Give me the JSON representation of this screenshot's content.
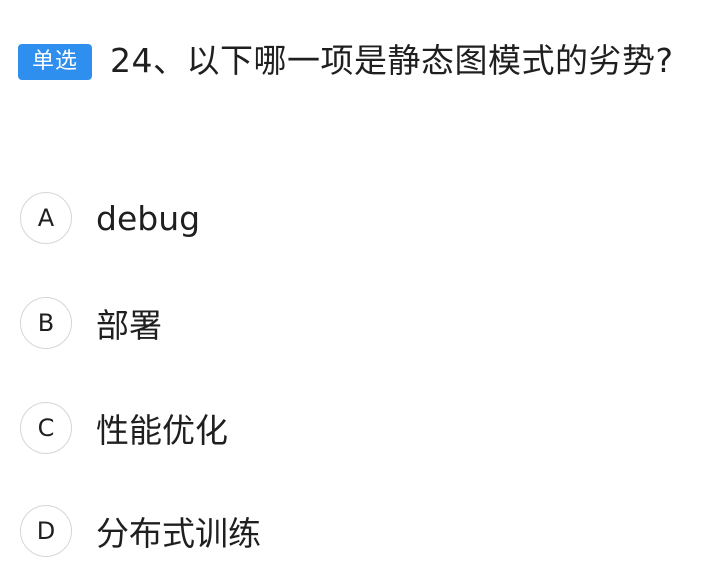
{
  "question": {
    "type_badge": "单选",
    "text": "24、以下哪一项是静态图模式的劣势?"
  },
  "options": [
    {
      "letter": "A",
      "text": "debug"
    },
    {
      "letter": "B",
      "text": "部署"
    },
    {
      "letter": "C",
      "text": "性能优化"
    },
    {
      "letter": "D",
      "text": "分布式训练"
    }
  ],
  "colors": {
    "badge_bg": "#2f8fef",
    "badge_text": "#ffffff",
    "text": "#1f1f1f",
    "circle_border": "#d6d6d6"
  }
}
